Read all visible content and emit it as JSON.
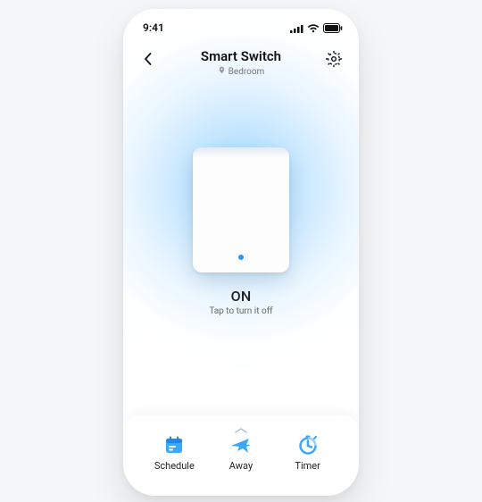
{
  "statusbar": {
    "time": "9:41"
  },
  "header": {
    "title": "Smart Switch",
    "location": "Bedroom"
  },
  "switch": {
    "state": "ON",
    "hint": "Tap to turn it off"
  },
  "bottom": {
    "schedule": "Schedule",
    "away": "Away",
    "timer": "Timer"
  },
  "colors": {
    "accent": "#3aa7ff",
    "accentDeep": "#1e9bff"
  }
}
